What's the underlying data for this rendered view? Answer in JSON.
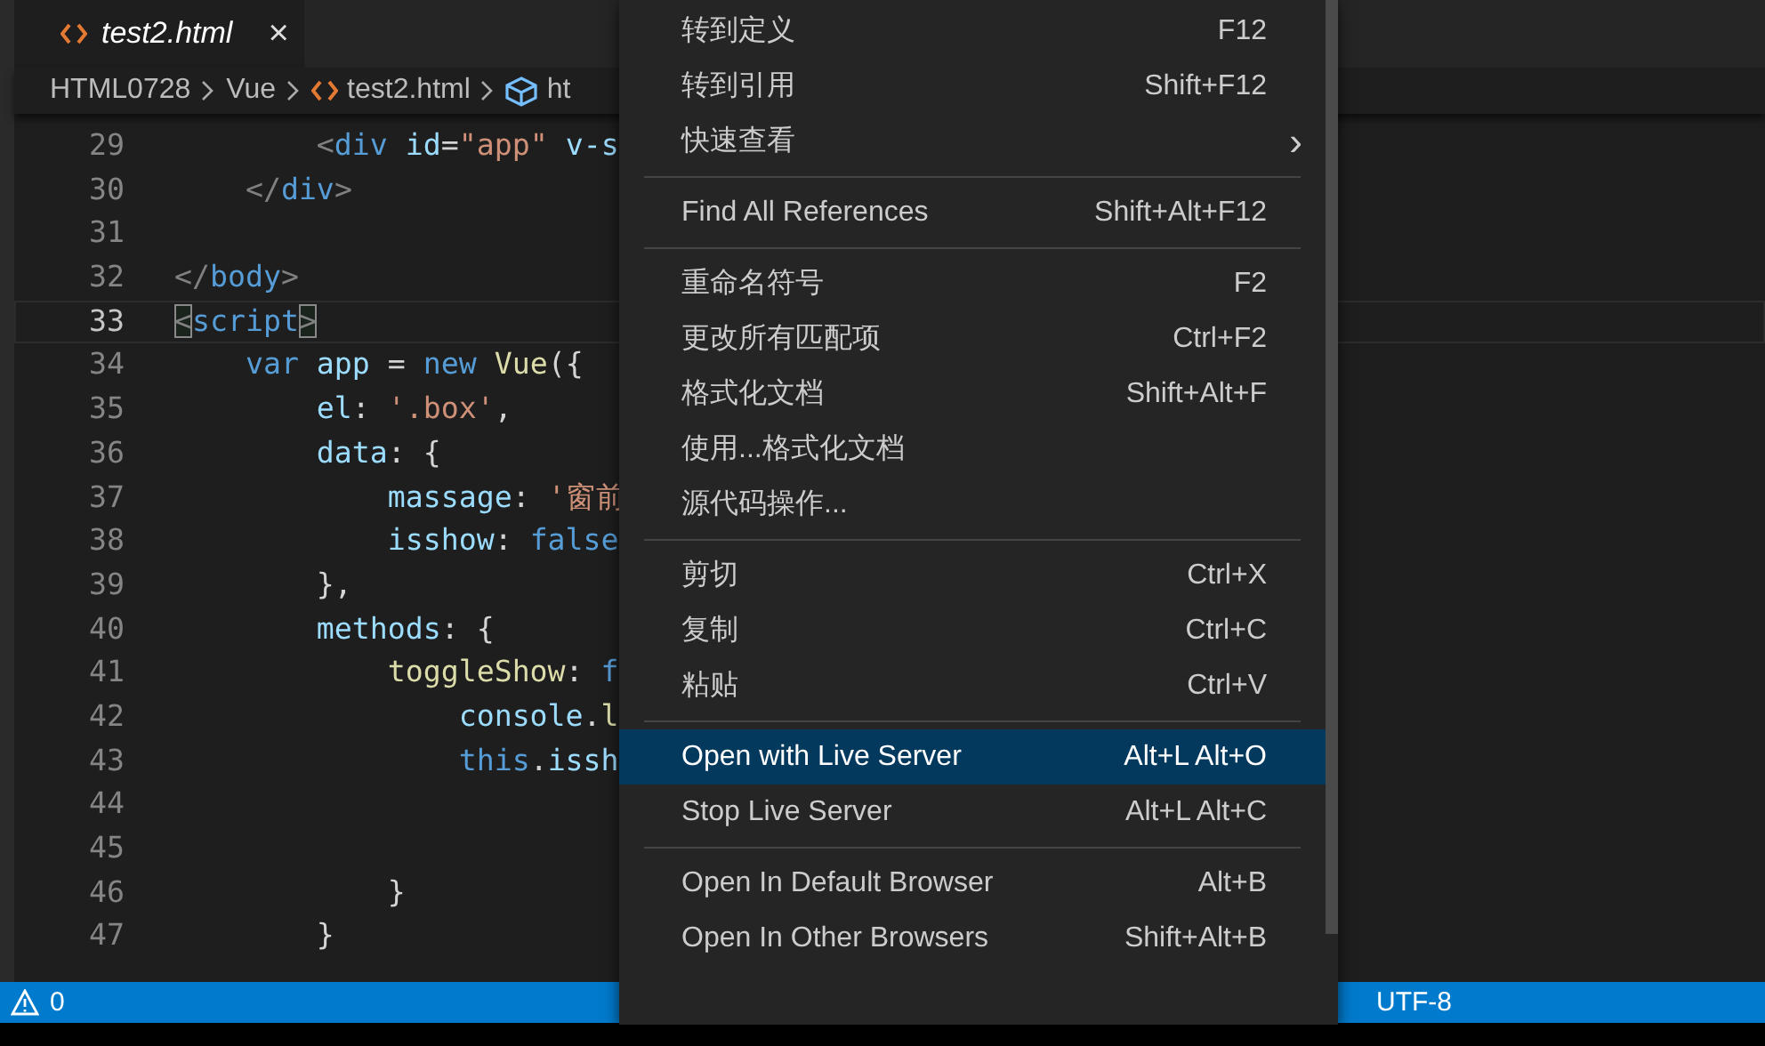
{
  "tab": {
    "title": "test2.html",
    "close": "×"
  },
  "breadcrumbs": [
    {
      "kind": "folder",
      "label": "HTML0728"
    },
    {
      "kind": "folder",
      "label": "Vue"
    },
    {
      "kind": "file",
      "label": "test2.html"
    },
    {
      "kind": "element",
      "label": "ht"
    }
  ],
  "code_lines": [
    {
      "number": "29",
      "current": false,
      "tokens": [
        {
          "kind": "punct",
          "text": "        <"
        },
        {
          "kind": "tag",
          "text": "div"
        },
        {
          "kind": "attr",
          "text": " id"
        },
        {
          "kind": "plain",
          "text": "="
        },
        {
          "kind": "string",
          "text": "\"app\""
        },
        {
          "kind": "attr",
          "text": " v-s"
        }
      ]
    },
    {
      "number": "30",
      "current": false,
      "tokens": [
        {
          "kind": "punct",
          "text": "    </"
        },
        {
          "kind": "tag",
          "text": "div"
        },
        {
          "kind": "punct",
          "text": ">"
        }
      ]
    },
    {
      "number": "31",
      "current": false
    },
    {
      "number": "32",
      "current": false,
      "tokens": [
        {
          "kind": "punct",
          "text": "</"
        },
        {
          "kind": "tag",
          "text": "body"
        },
        {
          "kind": "punct",
          "text": ">"
        }
      ]
    },
    {
      "number": "33",
      "current": true,
      "tokens": [
        {
          "kind": "match",
          "text": "<"
        },
        {
          "kind": "tag",
          "text": "script"
        },
        {
          "kind": "match",
          "text": ">"
        }
      ]
    },
    {
      "number": "34",
      "current": false,
      "tokens": [
        {
          "kind": "keyword",
          "text": "    var"
        },
        {
          "kind": "prop",
          "text": " app"
        },
        {
          "kind": "plain",
          "text": " = "
        },
        {
          "kind": "keyword",
          "text": "new"
        },
        {
          "kind": "func",
          "text": " Vue"
        },
        {
          "kind": "plain",
          "text": "({"
        }
      ]
    },
    {
      "number": "35",
      "current": false,
      "tokens": [
        {
          "kind": "prop",
          "text": "        el"
        },
        {
          "kind": "plain",
          "text": ": "
        },
        {
          "kind": "string",
          "text": "'.box'"
        },
        {
          "kind": "plain",
          "text": ","
        }
      ]
    },
    {
      "number": "36",
      "current": false,
      "tokens": [
        {
          "kind": "prop",
          "text": "        data"
        },
        {
          "kind": "plain",
          "text": ": {"
        }
      ]
    },
    {
      "number": "37",
      "current": false,
      "tokens": [
        {
          "kind": "prop",
          "text": "            massage"
        },
        {
          "kind": "plain",
          "text": ": "
        },
        {
          "kind": "string",
          "text": "'窗前"
        }
      ]
    },
    {
      "number": "38",
      "current": false,
      "tokens": [
        {
          "kind": "prop",
          "text": "            isshow"
        },
        {
          "kind": "plain",
          "text": ": "
        },
        {
          "kind": "keyword",
          "text": "false"
        }
      ]
    },
    {
      "number": "39",
      "current": false,
      "tokens": [
        {
          "kind": "plain",
          "text": "        },"
        }
      ]
    },
    {
      "number": "40",
      "current": false,
      "tokens": [
        {
          "kind": "prop",
          "text": "        methods"
        },
        {
          "kind": "plain",
          "text": ": {"
        }
      ]
    },
    {
      "number": "41",
      "current": false,
      "tokens": [
        {
          "kind": "func",
          "text": "            toggleShow"
        },
        {
          "kind": "plain",
          "text": ": "
        },
        {
          "kind": "keyword",
          "text": "f"
        }
      ]
    },
    {
      "number": "42",
      "current": false,
      "tokens": [
        {
          "kind": "prop",
          "text": "                console"
        },
        {
          "kind": "plain",
          "text": "."
        },
        {
          "kind": "func",
          "text": "l"
        }
      ]
    },
    {
      "number": "43",
      "current": false,
      "tokens": [
        {
          "kind": "keyword",
          "text": "                this"
        },
        {
          "kind": "plain",
          "text": "."
        },
        {
          "kind": "prop",
          "text": "issh"
        }
      ]
    },
    {
      "number": "44",
      "current": false
    },
    {
      "number": "45",
      "current": false
    },
    {
      "number": "46",
      "current": false,
      "tokens": [
        {
          "kind": "plain",
          "text": "            }"
        }
      ]
    },
    {
      "number": "47",
      "current": false,
      "tokens": [
        {
          "kind": "plain",
          "text": "        }"
        }
      ]
    }
  ],
  "context_menu": [
    {
      "kind": "item",
      "label": "转到定义",
      "shortcut": "F12",
      "selected": false
    },
    {
      "kind": "item",
      "label": "转到引用",
      "shortcut": "Shift+F12",
      "selected": false
    },
    {
      "kind": "submenu",
      "label": "快速查看",
      "shortcut": "›",
      "selected": false
    },
    {
      "kind": "separator"
    },
    {
      "kind": "item",
      "label": "Find All References",
      "shortcut": "Shift+Alt+F12",
      "selected": false
    },
    {
      "kind": "separator"
    },
    {
      "kind": "item",
      "label": "重命名符号",
      "shortcut": "F2",
      "selected": false
    },
    {
      "kind": "item",
      "label": "更改所有匹配项",
      "shortcut": "Ctrl+F2",
      "selected": false
    },
    {
      "kind": "item",
      "label": "格式化文档",
      "shortcut": "Shift+Alt+F",
      "selected": false
    },
    {
      "kind": "item",
      "label": "使用...格式化文档",
      "selected": false
    },
    {
      "kind": "item",
      "label": "源代码操作...",
      "selected": false
    },
    {
      "kind": "separator"
    },
    {
      "kind": "item",
      "label": "剪切",
      "shortcut": "Ctrl+X",
      "selected": false
    },
    {
      "kind": "item",
      "label": "复制",
      "shortcut": "Ctrl+C",
      "selected": false
    },
    {
      "kind": "item",
      "label": "粘贴",
      "shortcut": "Ctrl+V",
      "selected": false
    },
    {
      "kind": "separator"
    },
    {
      "kind": "item",
      "label": "Open with Live Server",
      "shortcut": "Alt+L Alt+O",
      "selected": true
    },
    {
      "kind": "item",
      "label": "Stop Live Server",
      "shortcut": "Alt+L Alt+C",
      "selected": false
    },
    {
      "kind": "separator"
    },
    {
      "kind": "item",
      "label": "Open In Default Browser",
      "shortcut": "Alt+B",
      "selected": false
    },
    {
      "kind": "item",
      "label": "Open In Other Browsers",
      "shortcut": "Shift+Alt+B",
      "selected": false
    }
  ],
  "status_bar": {
    "warnings": "0",
    "encoding": "UTF-8"
  }
}
